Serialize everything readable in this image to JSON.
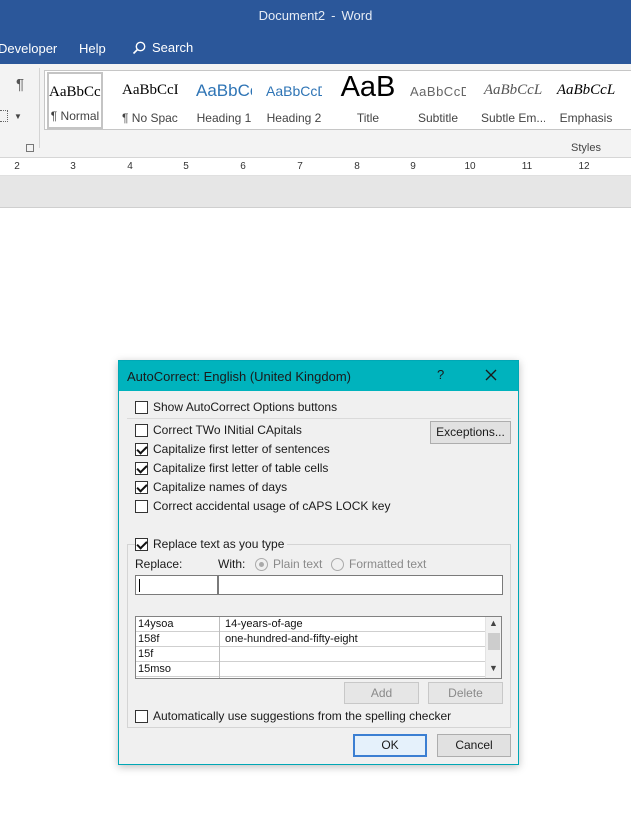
{
  "window": {
    "doc_name": "Document2",
    "separator": "-",
    "app_name": "Word",
    "title_bar_color": "#2b579a"
  },
  "tabs": {
    "developer": "Developer",
    "help": "Help",
    "search": "Search"
  },
  "ribbon": {
    "paragraph_mark": "¶",
    "styles_group_label": "Styles",
    "styles": [
      {
        "preview": "AaBbCcI",
        "label": "¶ Normal"
      },
      {
        "preview": "AaBbCcI",
        "label": "¶ No Spac..."
      },
      {
        "preview": "AaBbCc",
        "label": "Heading 1"
      },
      {
        "preview": "AaBbCcD",
        "label": "Heading 2"
      },
      {
        "preview": "AaB",
        "label": "Title"
      },
      {
        "preview": "AaBbCcD",
        "label": "Subtitle"
      },
      {
        "preview": "AaBbCcL",
        "label": "Subtle Em..."
      },
      {
        "preview": "AaBbCcL",
        "label": "Emphasis"
      }
    ]
  },
  "ruler": {
    "numbers": [
      "2",
      "3",
      "4",
      "5",
      "6",
      "7",
      "8",
      "9",
      "10",
      "11",
      "12"
    ]
  },
  "dialog": {
    "title": "AutoCorrect: English (United Kingdom)",
    "help": "?",
    "accent_color": "#00b3bd",
    "options": {
      "show_options_buttons": "Show AutoCorrect Options buttons",
      "correct_two_initial": "Correct TWo INitial CApitals",
      "cap_first_sentence": "Capitalize first letter of sentences",
      "cap_first_table_cells": "Capitalize first letter of table cells",
      "cap_names_days": "Capitalize names of days",
      "correct_caps_lock": "Correct accidental usage of cAPS LOCK key",
      "replace_as_you_type": "Replace text as you type",
      "auto_suggestions": "Automatically use suggestions from the spelling checker"
    },
    "checked": {
      "show_options_buttons": false,
      "correct_two_initial": false,
      "cap_first_sentence": true,
      "cap_first_table_cells": true,
      "cap_names_days": true,
      "correct_caps_lock": false,
      "replace_as_you_type": true,
      "auto_suggestions": false
    },
    "exceptions_button": "Exceptions...",
    "replace_label": "Replace:",
    "with_label": "With:",
    "plain_text": "Plain text",
    "formatted_text": "Formatted text",
    "replace_value": "",
    "with_value": "",
    "entries": [
      {
        "replace": "14ysoa",
        "with": "14-years-of-age"
      },
      {
        "replace": "158f",
        "with": "one-hundred-and-fifty-eight"
      },
      {
        "replace": "15f",
        "with": ""
      },
      {
        "replace": "15mso",
        "with": ""
      }
    ],
    "add_button": "Add",
    "delete_button": "Delete",
    "ok_button": "OK",
    "cancel_button": "Cancel"
  }
}
